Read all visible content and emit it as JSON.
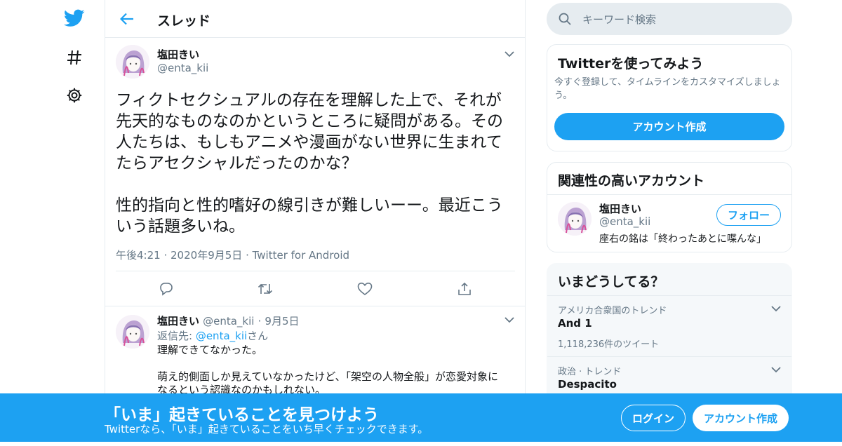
{
  "colors": {
    "accent": "#1da1f2",
    "text": "#14171a",
    "muted": "#657786",
    "border": "#e6ecf0"
  },
  "nav": {
    "icons": [
      "twitter-bird-icon",
      "hashtag-icon",
      "gear-icon"
    ]
  },
  "header": {
    "title": "スレッド"
  },
  "main_tweet": {
    "name": "塩田きい",
    "handle": "@enta_kii",
    "text": "フィクトセクシュアルの存在を理解した上で、それが先天的なものなのかというところに疑問がある。その人たちは、もしもアニメや漫画がない世界に生まれてたらアセクシャルだったのかな？\n\n性的指向と性的嗜好の線引きが難しいーー。最近こういう話題多いね。",
    "time": "午後4:21",
    "date": "2020年9月5日",
    "source": "Twitter for Android",
    "actions": [
      "reply-icon",
      "retweet-icon",
      "like-icon",
      "share-icon"
    ]
  },
  "reply_tweet": {
    "name": "塩田きい",
    "handle": "@enta_kii",
    "date": "9月5日",
    "reply_to_prefix": "返信先: ",
    "reply_to_handle": "@enta_kii",
    "reply_to_suffix": "さん",
    "text": "理解できてなかった。\n\n萌え的側面しか見えていなかったけど、「架空の人物全般」が恋愛対象になるという認識なのかもしれない。"
  },
  "search": {
    "placeholder": "キーワード検索"
  },
  "signup_card": {
    "title": "Twitterを使ってみよう",
    "subtitle": "今すぐ登録して、タイムラインをカスタマイズしましょう。",
    "button": "アカウント作成"
  },
  "related_card": {
    "title": "関連性の高いアカウント",
    "name": "塩田きい",
    "handle": "@enta_kii",
    "bio": "座右の銘は「終わったあとに喋んな」",
    "follow": "フォロー"
  },
  "trends_card": {
    "title": "いまどうしてる？",
    "items": [
      {
        "context": "アメリカ合衆国のトレンド",
        "name": "And 1",
        "count": "1,118,236件のツイート"
      },
      {
        "context": "政治 · トレンド",
        "name": "Despacito",
        "count": ""
      }
    ]
  },
  "bottom_bar": {
    "title": "「いま」起きていることを見つけよう",
    "subtitle": "Twitterなら、「いま」起きていることをいち早くチェックできます。",
    "login": "ログイン",
    "signup": "アカウント作成"
  }
}
